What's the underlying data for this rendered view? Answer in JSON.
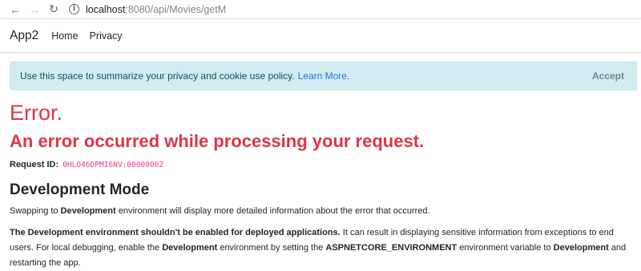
{
  "browser": {
    "back_icon": "←",
    "forward_icon": "→",
    "reload_icon": "↻",
    "info_icon": "i",
    "url_host": "localhost",
    "url_path": ":8080/api/Movies/getM"
  },
  "navbar": {
    "brand": "App2",
    "links": [
      "Home",
      "Privacy"
    ]
  },
  "cookie": {
    "text": "Use this space to summarize your privacy and cookie use policy.",
    "learn_more": "Learn More.",
    "accept": "Accept"
  },
  "error": {
    "title": "Error.",
    "subtitle": "An error occurred while processing your request.",
    "request_id_label": "Request ID:",
    "request_id": "0HLO46DPMI6NV:00000002"
  },
  "dev_mode": {
    "title": "Development Mode",
    "p1_a": "Swapping to ",
    "p1_b": "Development",
    "p1_c": " environment will display more detailed information about the error that occurred.",
    "p2_a": "The Development environment shouldn't be enabled for deployed applications.",
    "p2_b": " It can result in displaying sensitive information from exceptions to end users. For local debugging, enable the ",
    "p2_c": "Development",
    "p2_d": " environment by setting the ",
    "p2_e": "ASPNETCORE_ENVIRONMENT",
    "p2_f": " environment variable to ",
    "p2_g": "Development",
    "p2_h": " and restarting the app."
  }
}
